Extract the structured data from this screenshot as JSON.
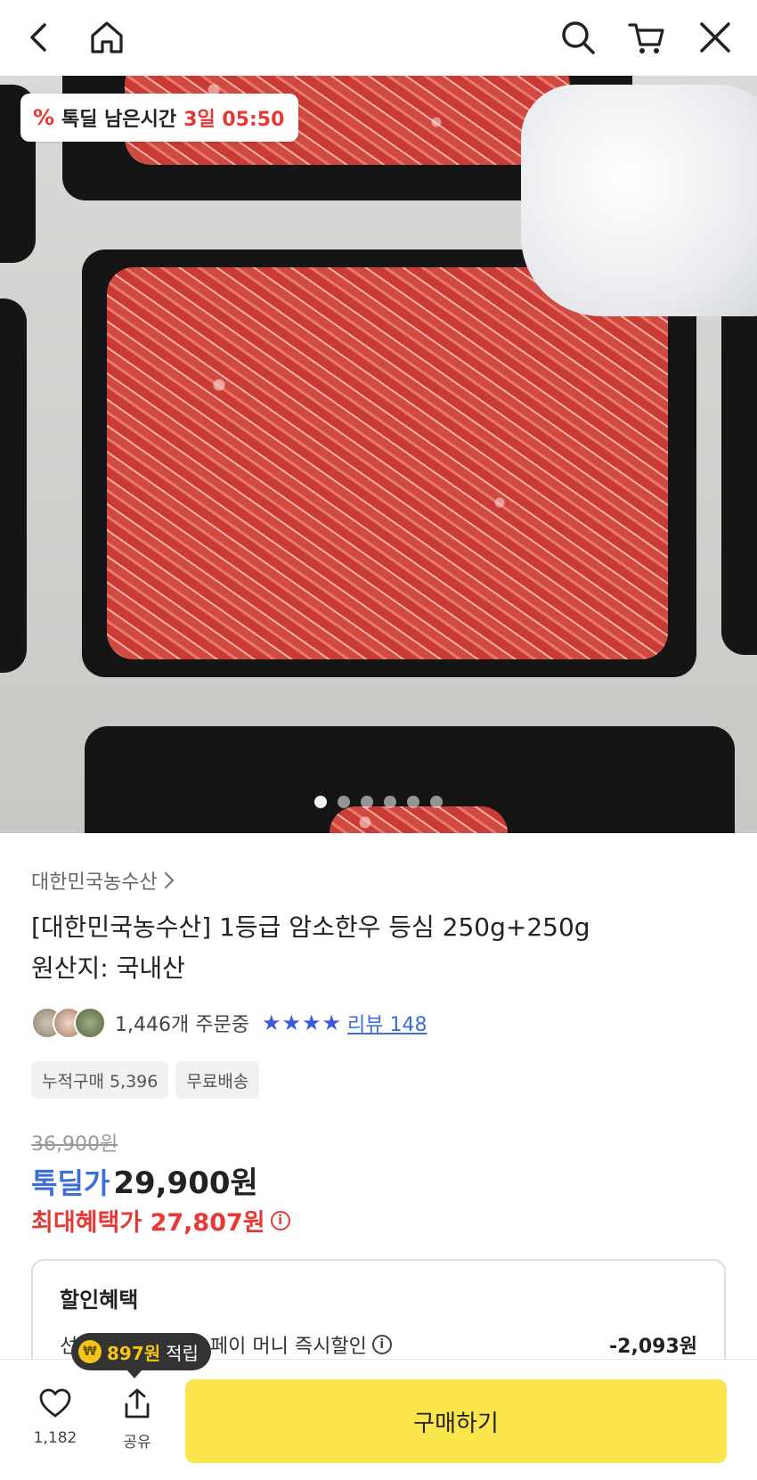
{
  "deal_banner": {
    "label": "톡딜 남은시간",
    "time_left": "3일 05:50"
  },
  "image_carousel": {
    "total": 6,
    "active_index": 0
  },
  "product": {
    "seller": "대한민국농수산",
    "title": "[대한민국농수산] 1등급 암소한우 등심 250g+250g",
    "origin": "원산지: 국내산",
    "orders": "1,446개 주문중",
    "rating_stars": 4,
    "review_label": "리뷰 148",
    "tags": [
      "누적구매 5,396",
      "무료배송"
    ]
  },
  "price": {
    "original": "36,900원",
    "deal_label": "톡딜가",
    "deal_value": "29,900원",
    "max_benefit": "최대혜택가 27,807원"
  },
  "discount": {
    "heading": "할인혜택",
    "row_label": "선착순할인 카카오페이 머니 즉시할인",
    "row_amount": "-2,093원"
  },
  "points": {
    "amount": "897원",
    "suffix": "적립"
  },
  "bottom_bar": {
    "like_count": "1,182",
    "share_label": "공유",
    "buy_label": "구매하기"
  },
  "colors": {
    "accent_blue": "#3b6fd6",
    "accent_red": "#e53935",
    "buy_yellow": "#fbe54c"
  }
}
